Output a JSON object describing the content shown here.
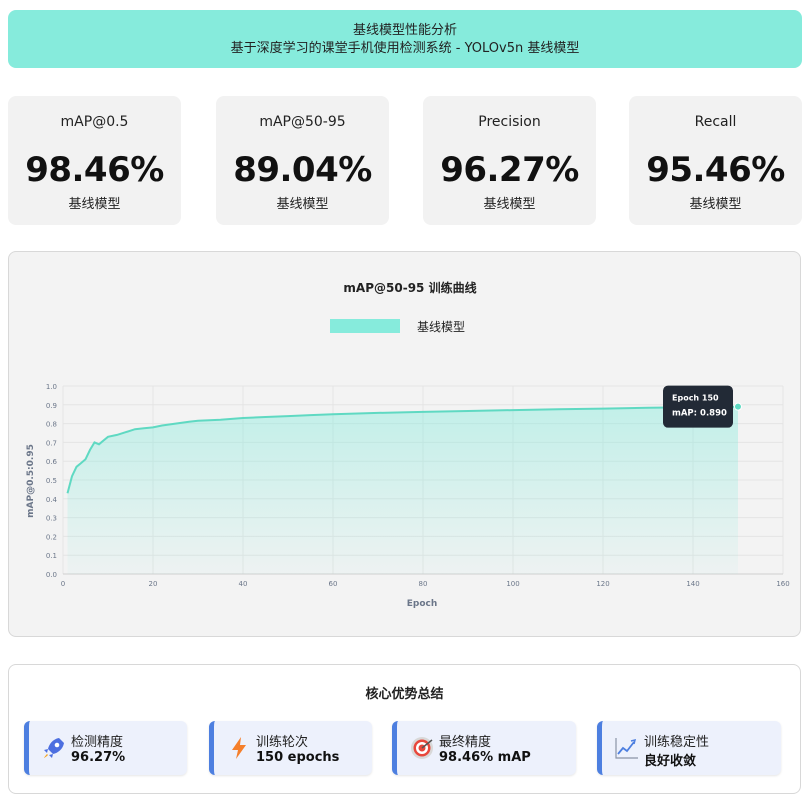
{
  "header": {
    "title": "基线模型性能分析",
    "subtitle": "基于深度学习的课堂手机使用检测系统 - YOLOv5n 基线模型"
  },
  "stats": [
    {
      "label": "mAP@0.5",
      "value": "98.46%",
      "sub": "基线模型"
    },
    {
      "label": "mAP@50-95",
      "value": "89.04%",
      "sub": "基线模型"
    },
    {
      "label": "Precision",
      "value": "96.27%",
      "sub": "基线模型"
    },
    {
      "label": "Recall",
      "value": "95.46%",
      "sub": "基线模型"
    }
  ],
  "chart_data": {
    "type": "area",
    "title": "mAP@50-95 训练曲线",
    "xlabel": "Epoch",
    "ylabel": "mAP@0.5:0.95",
    "xlim": [
      0,
      160
    ],
    "ylim": [
      0,
      1.0
    ],
    "xticks": [
      0,
      20,
      40,
      60,
      80,
      100,
      120,
      140,
      160
    ],
    "yticks": [
      0.0,
      0.1,
      0.2,
      0.3,
      0.4,
      0.5,
      0.6,
      0.7,
      0.8,
      0.9,
      1.0
    ],
    "grid": true,
    "legend_position": "top",
    "series": [
      {
        "name": "基线模型",
        "color": "#86ebdc",
        "line_color": "#5fd9c2",
        "x": [
          1,
          2,
          3,
          4,
          5,
          6,
          7,
          8,
          9,
          10,
          12,
          14,
          16,
          18,
          20,
          22,
          25,
          28,
          30,
          35,
          40,
          45,
          50,
          55,
          60,
          70,
          80,
          90,
          100,
          110,
          120,
          130,
          140,
          150
        ],
        "y": [
          0.43,
          0.52,
          0.57,
          0.59,
          0.61,
          0.66,
          0.7,
          0.69,
          0.71,
          0.73,
          0.74,
          0.755,
          0.77,
          0.775,
          0.78,
          0.79,
          0.8,
          0.81,
          0.815,
          0.82,
          0.83,
          0.835,
          0.84,
          0.845,
          0.85,
          0.857,
          0.862,
          0.867,
          0.872,
          0.876,
          0.88,
          0.884,
          0.887,
          0.89
        ]
      }
    ],
    "tooltip": {
      "title": "Epoch 150",
      "value": "mAP: 0.890"
    }
  },
  "summary": {
    "title": "核心优势总结",
    "items": [
      {
        "title": "检测精度",
        "value": "96.27%",
        "icon": "rocket-icon"
      },
      {
        "title": "训练轮次",
        "value": "150 epochs",
        "icon": "lightning-icon"
      },
      {
        "title": "最终精度",
        "value": "98.46% mAP",
        "icon": "target-icon"
      },
      {
        "title": "训练稳定性",
        "value": "良好收敛",
        "icon": "trend-chart-icon"
      }
    ]
  }
}
